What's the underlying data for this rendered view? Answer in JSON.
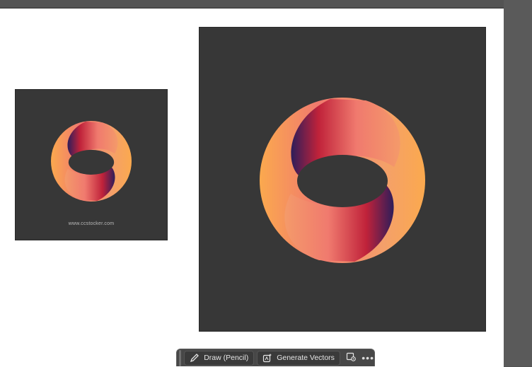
{
  "thumbnail": {
    "watermark": "www.ccstocker.com"
  },
  "taskbar": {
    "draw_label": "Draw (Pencil)",
    "generate_label": "Generate Vectors",
    "more_label": "•••"
  },
  "colors": {
    "canvas_bg": "#535353",
    "artboard_bg": "#ffffff",
    "artwork_bg": "#373737",
    "gradient": [
      "#fba94e",
      "#f07a6e",
      "#c0223a",
      "#2d1d5a"
    ]
  },
  "icons": [
    "pencil-icon",
    "generate-vectors-icon",
    "recolor-icon",
    "more-icon"
  ]
}
